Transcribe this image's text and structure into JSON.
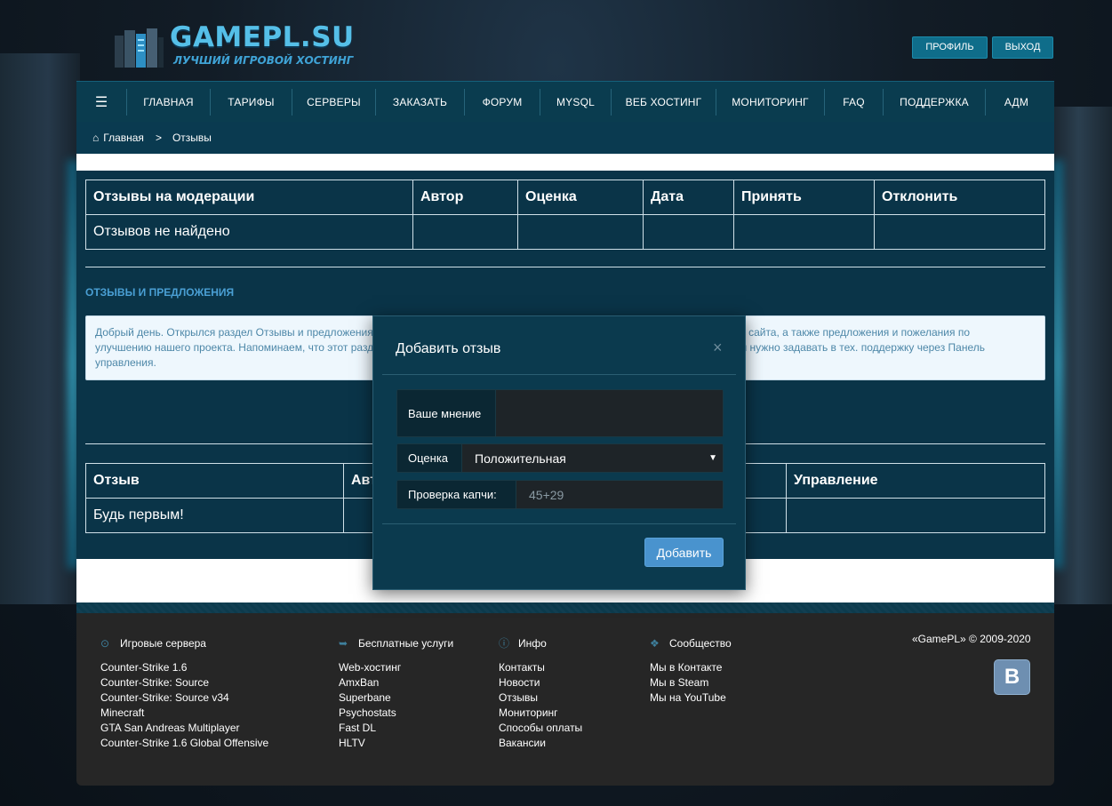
{
  "brand": {
    "title": "GAMEPL.SU",
    "subtitle": "ЛУЧШИЙ ИГРОВОЙ ХОСТИНГ",
    "accent": "#55bfe8"
  },
  "header": {
    "profile_label": "ПРОФИЛЬ",
    "logout_label": "ВЫХОД"
  },
  "nav": {
    "menu_icon": "menu-icon",
    "items": [
      "ГЛАВНАЯ",
      "ТАРИФЫ",
      "СЕРВЕРЫ",
      "ЗАКАЗАТЬ",
      "ФОРУМ",
      "MYSQL",
      "ВЕБ ХОСТИНГ",
      "МОНИТОРИНГ",
      "FAQ",
      "ПОДДЕРЖКА",
      "АДМ"
    ]
  },
  "breadcrumb": {
    "home": "Главная",
    "separator": ">",
    "current": "Отзывы"
  },
  "moderation_table": {
    "headers": [
      "Отзывы на модерации",
      "Автор",
      "Оценка",
      "Дата",
      "Принять",
      "Отклонить"
    ],
    "empty_text": "Отзывов не найдено"
  },
  "section": {
    "title": "ОТЗЫВЫ И ПРЕДЛОЖЕНИЯ",
    "info_line1_left": "Добрый день. Открылся раздел Отзывы и предложения.",
    "info_line1_right": "те сайта, а также предложения и пожелания по",
    "info_line2_left": "улучшению нашего проекта. Напоминаем, что этот разд",
    "info_line2_right": "ы нужно задавать в тех. поддержку через Панель",
    "info_line3": "управления."
  },
  "reviews_table": {
    "headers": [
      "Отзыв",
      "Авт",
      "Управление"
    ],
    "empty_text": "Будь первым!"
  },
  "modal": {
    "title": "Добавить отзыв",
    "close": "×",
    "opinion_label": "Ваше мнение",
    "opinion_value": "",
    "rating_label": "Оценка",
    "rating_value": "Положительная",
    "captcha_label": "Проверка капчи:",
    "captcha_placeholder": "45+29",
    "submit_label": "Добавить"
  },
  "footer": {
    "columns": [
      {
        "icon": "gamepad-icon",
        "title": "Игровые сервера",
        "links": [
          "Counter-Strike 1.6",
          "Counter-Strike: Source",
          "Counter-Strike: Source v34",
          "Minecraft",
          "GTA San Andreas Multiplayer",
          "Counter-Strike 1.6 Global Offensive"
        ]
      },
      {
        "icon": "share-icon",
        "title": "Бесплатные услуги",
        "links": [
          "Web-хостинг",
          "AmxBan",
          "Superbane",
          "Psychostats",
          "Fast DL",
          "HLTV"
        ]
      },
      {
        "icon": "info-icon",
        "title": "Инфо",
        "links": [
          "Контакты",
          "Новости",
          "Отзывы",
          "Мониторинг",
          "Способы оплаты",
          "Вакансии"
        ]
      },
      {
        "icon": "community-icon",
        "title": "Сообщество",
        "links": [
          "Мы в Контакте",
          "Мы в Steam",
          "Мы на YouTube"
        ]
      }
    ],
    "copyright": "«GamePL» © 2009-2020",
    "vk_label": "В"
  }
}
